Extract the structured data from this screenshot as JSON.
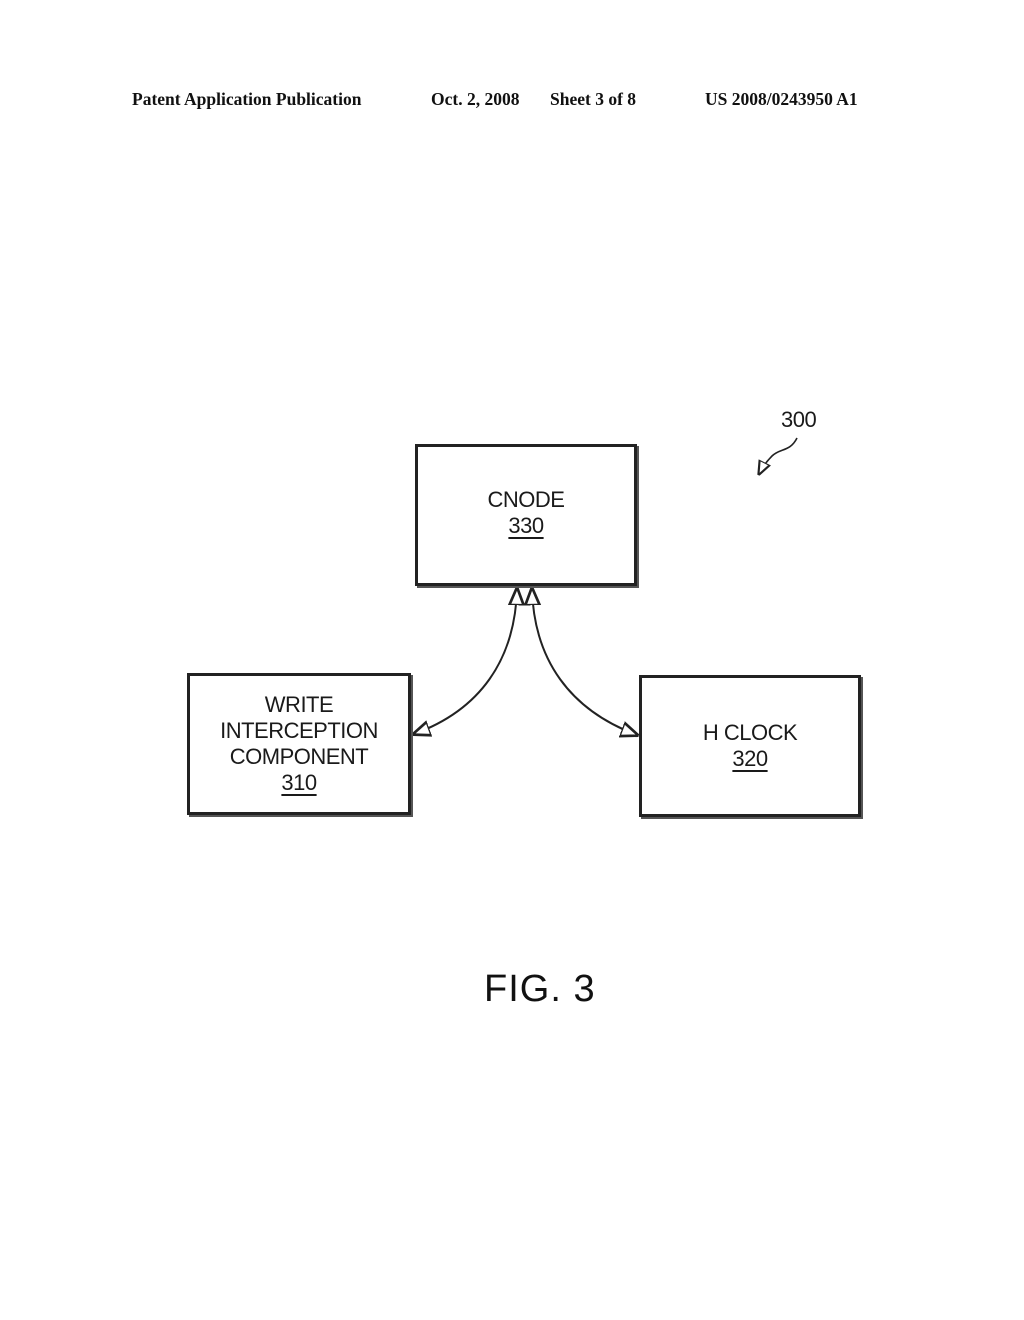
{
  "header": {
    "publication": "Patent Application Publication",
    "date": "Oct. 2, 2008",
    "sheet": "Sheet 3 of 8",
    "number": "US 2008/0243950 A1"
  },
  "diagram": {
    "reference": "300",
    "nodes": [
      {
        "id": "cnode",
        "lines": [
          "CNODE"
        ],
        "ref": "330"
      },
      {
        "id": "write-interception",
        "lines": [
          "WRITE",
          "INTERCEPTION",
          "COMPONENT"
        ],
        "ref": "310"
      },
      {
        "id": "hclock",
        "lines": [
          "H CLOCK"
        ],
        "ref": "320"
      }
    ],
    "edges": [
      {
        "from": "cnode",
        "to": "write-interception",
        "direction": "bidirectional"
      },
      {
        "from": "cnode",
        "to": "hclock",
        "direction": "bidirectional"
      }
    ]
  },
  "figure_label": "FIG. 3"
}
